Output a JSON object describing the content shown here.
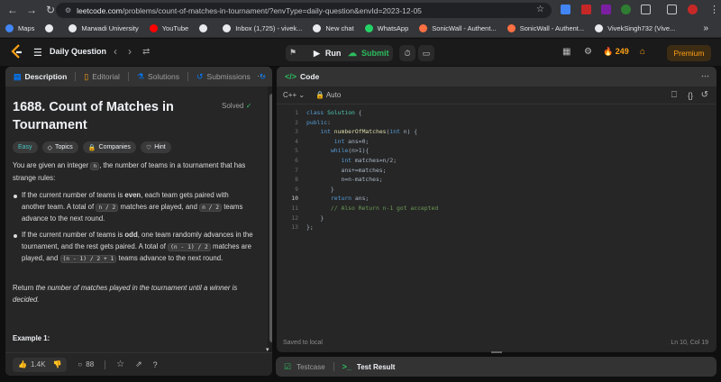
{
  "browser": {
    "url_host": "leetcode.com",
    "url_path": "/problems/count-of-matches-in-tournament/?envType=daily-question&envId=2023-12-05",
    "bookmarks": [
      {
        "label": "Maps",
        "color": "#4285f4"
      },
      {
        "label": "",
        "color": "#e8eaed"
      },
      {
        "label": "Marwadi University",
        "color": "#e8eaed"
      },
      {
        "label": "YouTube",
        "color": "#ff0000"
      },
      {
        "label": "",
        "color": "#e8eaed"
      },
      {
        "label": "Inbox (1,725) - vivek...",
        "color": "#e8eaed"
      },
      {
        "label": "New chat",
        "color": "#e8eaed"
      },
      {
        "label": "WhatsApp",
        "color": "#25d366"
      },
      {
        "label": "SonicWall - Authent...",
        "color": "#ff7043"
      },
      {
        "label": "SonicWall - Authent...",
        "color": "#ff7043"
      },
      {
        "label": "VivekSingh732 (Vive...",
        "color": "#e8eaed"
      }
    ],
    "bookmarks_more": "»"
  },
  "topnav": {
    "daily_label": "Daily Question",
    "run_label": "Run",
    "submit_label": "Submit",
    "streak": "249",
    "premium_label": "Premium"
  },
  "left_tabs": [
    {
      "label": "Description",
      "icon": "description-icon"
    },
    {
      "label": "Editorial",
      "icon": "book-icon"
    },
    {
      "label": "Solutions",
      "icon": "flask-icon"
    },
    {
      "label": "Submissions",
      "icon": "history-icon"
    }
  ],
  "problem": {
    "title": "1688. Count of Matches in Tournament",
    "status": "Solved",
    "chips": [
      "Easy",
      "Topics",
      "Companies",
      "Hint"
    ],
    "p1_a": "You are given an integer",
    "p1_code": "n",
    "p1_b": ", the number of teams in a tournament that has strange rules:",
    "b1_a": "If the current number of teams is",
    "b1_bold": "even",
    "b1_b": ", each team gets paired with another team. A total of",
    "b1_code1": "n / 2",
    "b1_c": "matches are played, and",
    "b1_code2": "n / 2",
    "b1_d": "teams advance to the next round.",
    "b2_a": "If the current number of teams is",
    "b2_bold": "odd",
    "b2_b": ", one team randomly advances in the tournament, and the rest gets paired. A total of",
    "b2_code1": "(n - 1) / 2",
    "b2_c": "matches are played, and",
    "b2_code2": "(n - 1) / 2 + 1",
    "b2_d": "teams advance to the next round.",
    "p2_a": "Return",
    "p2_italic": "the number of matches played in the tournament until a winner is decided.",
    "example_heading": "Example 1:"
  },
  "bottom": {
    "likes": "1.4K",
    "comments": "88"
  },
  "code_panel": {
    "title": "Code",
    "language": "C++",
    "mode": "Auto",
    "status_left": "Saved to local",
    "status_right": "Ln 10, Col 19"
  },
  "code_lines": [
    "class Solution {",
    "public:",
    "    int numberOfMatches(int n) {",
    "        int ans=0;",
    "       while(n>1){",
    "          int matches=n/2;",
    "          ans+=matches;",
    "          n=n-matches;",
    "       }",
    "       return ans;",
    "       // Also Return n-1 got accepted",
    "    }",
    "};"
  ],
  "testcase": {
    "testcase_label": "Testcase",
    "result_label": "Test Result"
  }
}
